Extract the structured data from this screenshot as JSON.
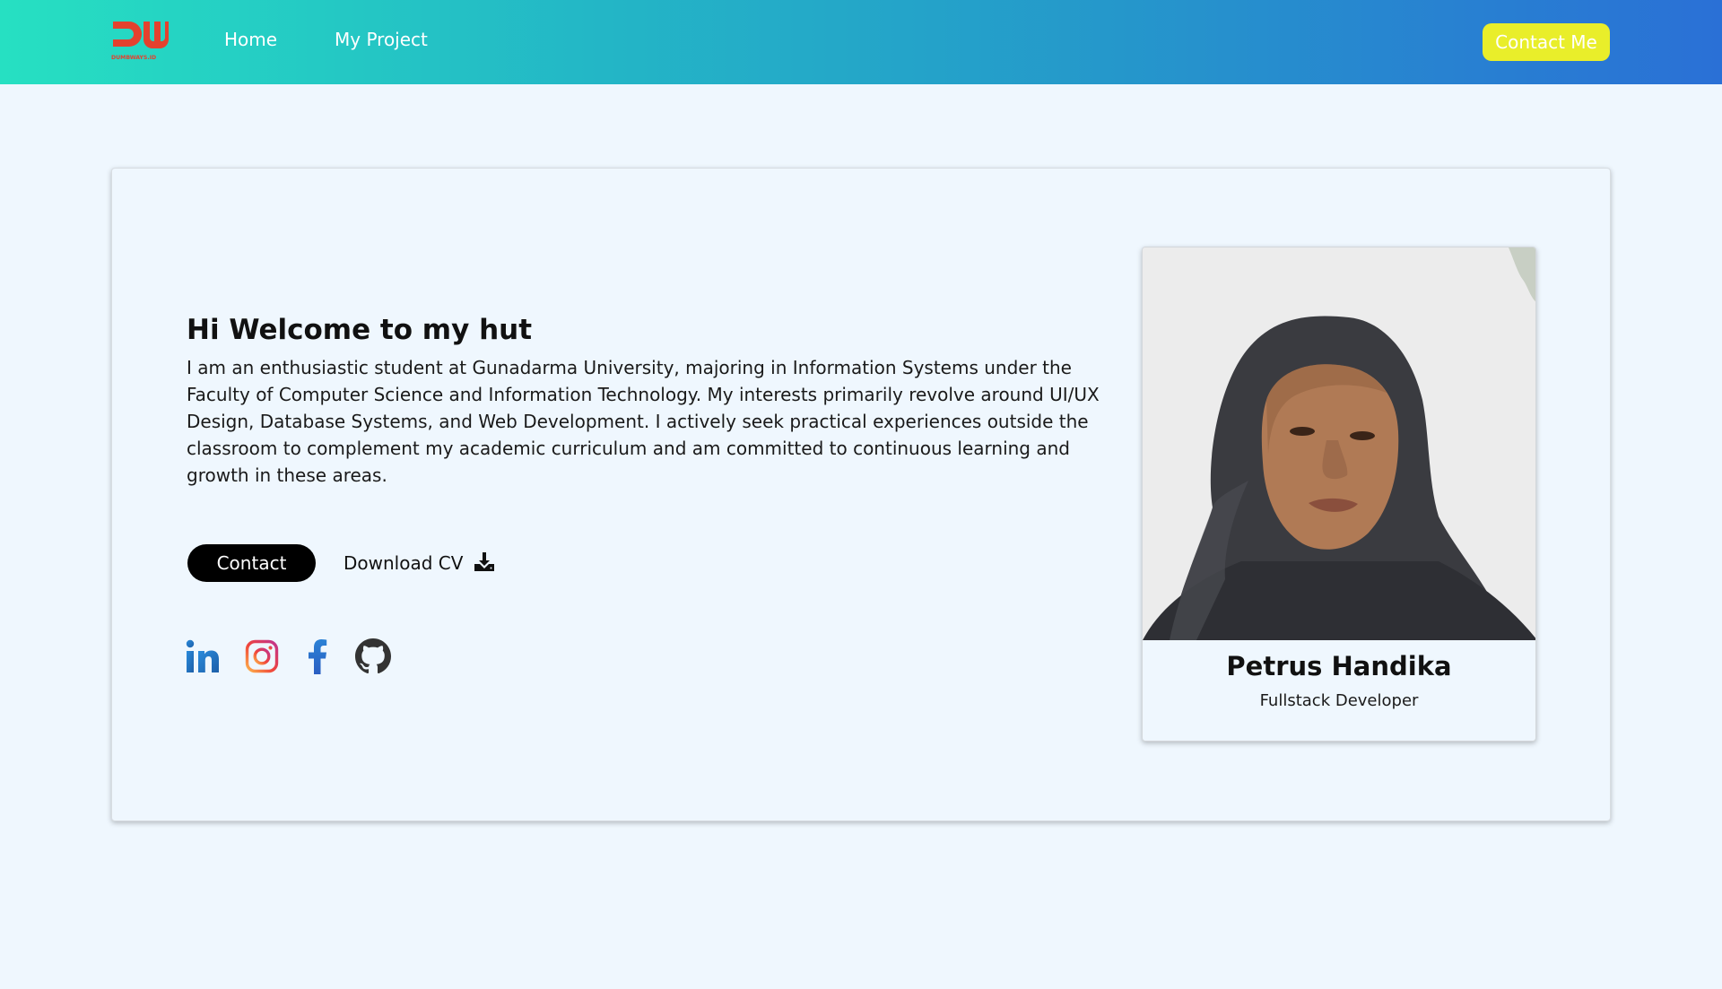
{
  "navbar": {
    "logo_text": "DUMBWAYS.ID",
    "links": [
      {
        "label": "Home"
      },
      {
        "label": "My Project"
      }
    ],
    "contact_button": "Contact Me"
  },
  "hero": {
    "headline": "Hi Welcome to my hut",
    "bio": "I am an enthusiastic student at Gunadarma University, majoring in Information Systems under the Faculty of Computer Science and Information Technology. My interests primarily revolve around UI/UX Design, Database Systems, and Web Development. I actively seek practical experiences outside the classroom to complement my academic curriculum and am committed to continuous learning and growth in these areas.",
    "contact_button": "Contact",
    "download_cv": "Download CV",
    "download_icon": "download-icon",
    "socials": [
      {
        "icon": "linkedin-icon"
      },
      {
        "icon": "instagram-icon"
      },
      {
        "icon": "facebook-icon"
      },
      {
        "icon": "github-icon"
      }
    ]
  },
  "profile": {
    "name": "Petrus Handika",
    "role": "Fullstack Developer"
  },
  "colors": {
    "nav_gradient_start": "#26e0c2",
    "nav_gradient_end": "#2a70d6",
    "accent_yellow": "#e9ee2a",
    "page_bg": "#eff7fe",
    "logo_red": "#e4412e"
  }
}
